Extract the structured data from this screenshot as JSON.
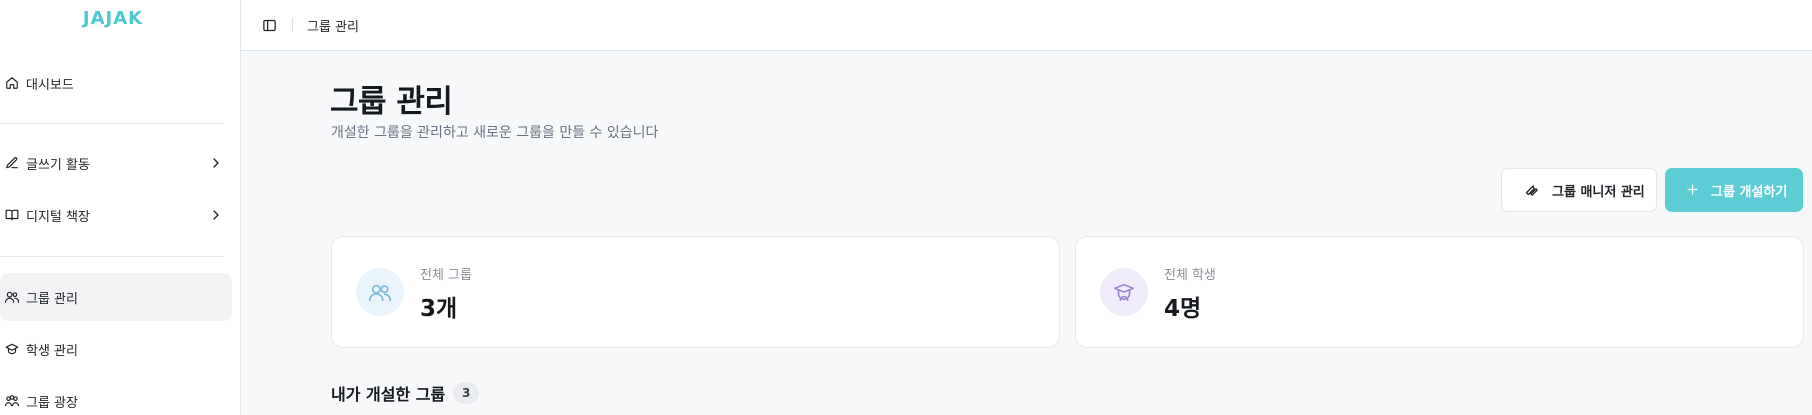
{
  "sidebar": {
    "logo": "JAJAK",
    "items": [
      {
        "label": "대시보드",
        "icon": "home-icon"
      },
      {
        "label": "글쓰기 활동",
        "icon": "pen-icon"
      },
      {
        "label": "디지털 책장",
        "icon": "book-icon"
      },
      {
        "label": "그룹 관리",
        "icon": "users-icon",
        "active": true
      },
      {
        "label": "학생 관리",
        "icon": "graduation-cap-icon"
      },
      {
        "label": "그룹 광장",
        "icon": "group-plaza-icon"
      }
    ]
  },
  "topbar": {
    "breadcrumb": "그룹 관리"
  },
  "page": {
    "title": "그룹 관리",
    "subtitle": "개설한 그룹을 관리하고 새로운 그룹을 만들 수 있습니다"
  },
  "actions": {
    "manager_label": "그룹 매니저 관리",
    "create_label": "그룹 개설하기"
  },
  "stats": [
    {
      "label": "전체 그룹",
      "value": "3개",
      "icon": "users-icon"
    },
    {
      "label": "전체 학생",
      "value": "4명",
      "icon": "student-icon"
    }
  ],
  "section": {
    "title": "내가 개설한 그룹",
    "count": "3"
  },
  "colors": {
    "brand": "#4fc7cf",
    "primary_button": "#5ccdd5",
    "active_nav_bg": "#f2f3f5",
    "main_bg": "#f7f8fa"
  }
}
